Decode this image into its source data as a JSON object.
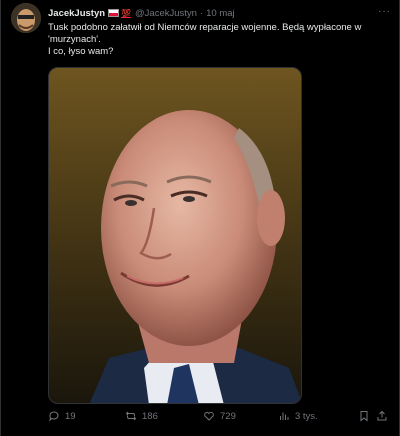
{
  "tweet": {
    "author_name": "JacekJustyn",
    "emoji_100": "💯",
    "handle": "@JacekJustyn",
    "separator": "·",
    "time": "10 maj",
    "text_line1": "Tusk podobno załatwił od Niemców reparacje wojenne. Będą wypłacone w",
    "text_line2": "'murzynach'.",
    "text_line3": "I co, łyso wam?"
  },
  "actions": {
    "replies": "19",
    "reposts": "186",
    "likes": "729",
    "views": "3 tys."
  },
  "icons": [
    "avatar",
    "flag-poland-icon",
    "more-icon",
    "reply-icon",
    "repost-icon",
    "like-icon",
    "views-icon",
    "bookmark-icon",
    "share-icon"
  ],
  "colors": {
    "background": "#000000",
    "text": "#e7e9ea",
    "muted": "#71767b",
    "divider": "#2f3336"
  }
}
